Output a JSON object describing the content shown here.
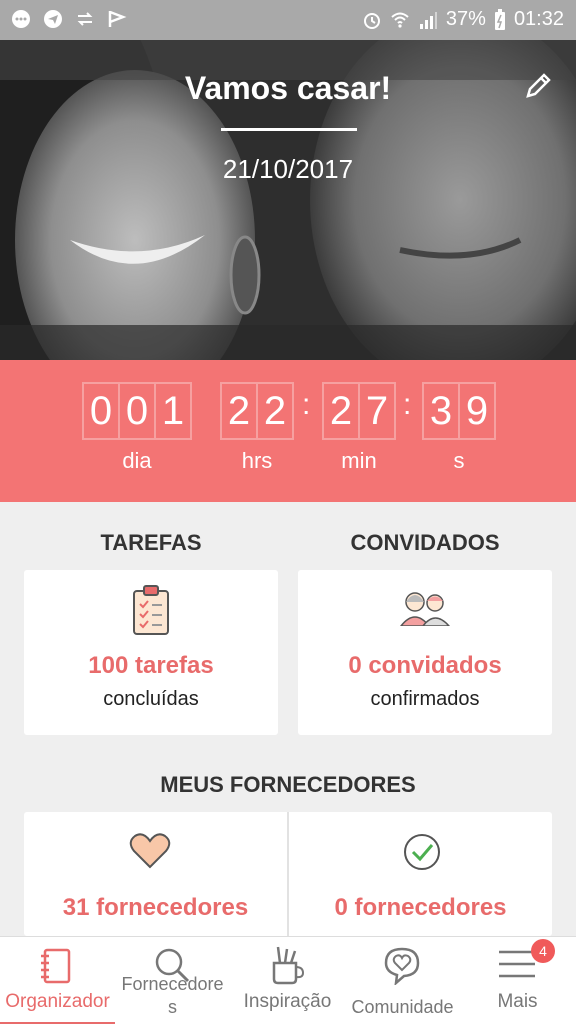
{
  "status_bar": {
    "battery": "37%",
    "time": "01:32"
  },
  "hero": {
    "title": "Vamos casar!",
    "date": "21/10/2017"
  },
  "countdown": {
    "days": [
      "0",
      "0",
      "1"
    ],
    "hours": [
      "2",
      "2"
    ],
    "minutes": [
      "2",
      "7"
    ],
    "seconds": [
      "3",
      "9"
    ],
    "labels": {
      "days": "dia",
      "hours": "hrs",
      "minutes": "min",
      "seconds": "s"
    }
  },
  "tasks": {
    "title": "TAREFAS",
    "count": "100 tarefas",
    "sub": "concluídas"
  },
  "guests": {
    "title": "CONVIDADOS",
    "count": "0 convidados",
    "sub": "confirmados"
  },
  "suppliers": {
    "title": "MEUS FORNECEDORES",
    "saved_count": "31 fornecedores",
    "hired_count": "0 fornecedores"
  },
  "nav": {
    "items": [
      {
        "label": "Organizador",
        "icon": "notebook-icon"
      },
      {
        "label": "Fornecedores",
        "icon": "search-icon"
      },
      {
        "label": "Inspiração",
        "icon": "pencil-cup-icon"
      },
      {
        "label": "Comunidade",
        "icon": "heart-bubble-icon"
      },
      {
        "label": "Mais",
        "icon": "menu-icon"
      }
    ],
    "badge": "4"
  },
  "colors": {
    "accent": "#f37474",
    "accent_text": "#e86b6b",
    "green": "#4caf50"
  }
}
